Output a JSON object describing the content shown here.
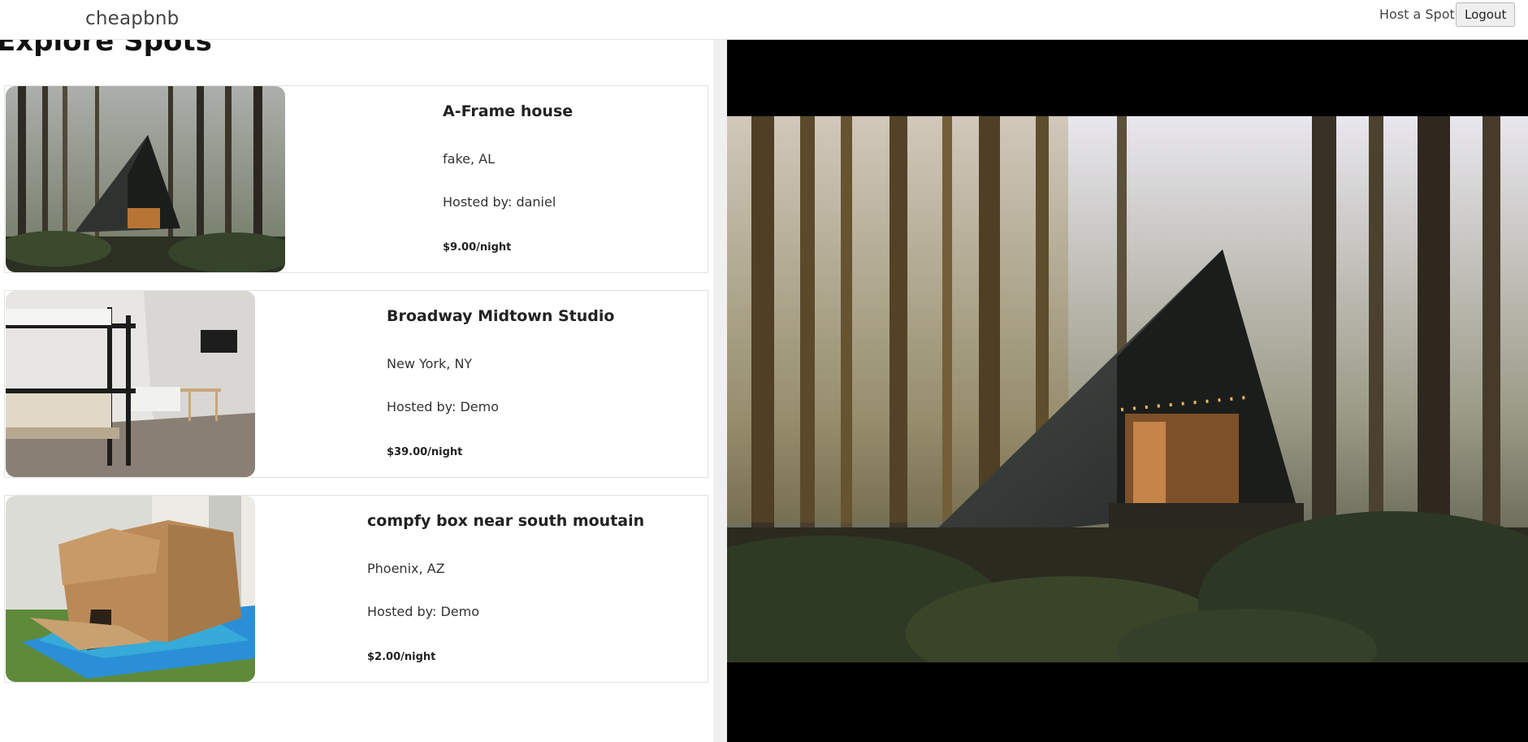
{
  "navbar": {
    "brand": "cheapbnb",
    "host_link": "Host a Spot",
    "logout_label": "Logout"
  },
  "main": {
    "title": "Explore Spots"
  },
  "spots": [
    {
      "name": "A-Frame house",
      "location": "fake, AL",
      "host": "Hosted by: daniel",
      "price": "$9.00/night",
      "image": "a-frame-cabin-in-forest-photo"
    },
    {
      "name": "Broadway Midtown Studio",
      "location": "New York, NY",
      "host": "Hosted by: Demo",
      "price": "$39.00/night",
      "image": "studio-bedroom-bunk-bed-photo"
    },
    {
      "name": "compfy box near south moutain",
      "location": "Phoenix, AZ",
      "host": "Hosted by: Demo",
      "price": "$2.00/night",
      "image": "cardboard-box-on-grass-photo"
    }
  ],
  "preview": {
    "image": "a-frame-cabin-in-forest-photo-large"
  },
  "colors": {
    "border": "#e2e2e2",
    "divider": "#f0f0f0",
    "preview_background": "#000000"
  }
}
